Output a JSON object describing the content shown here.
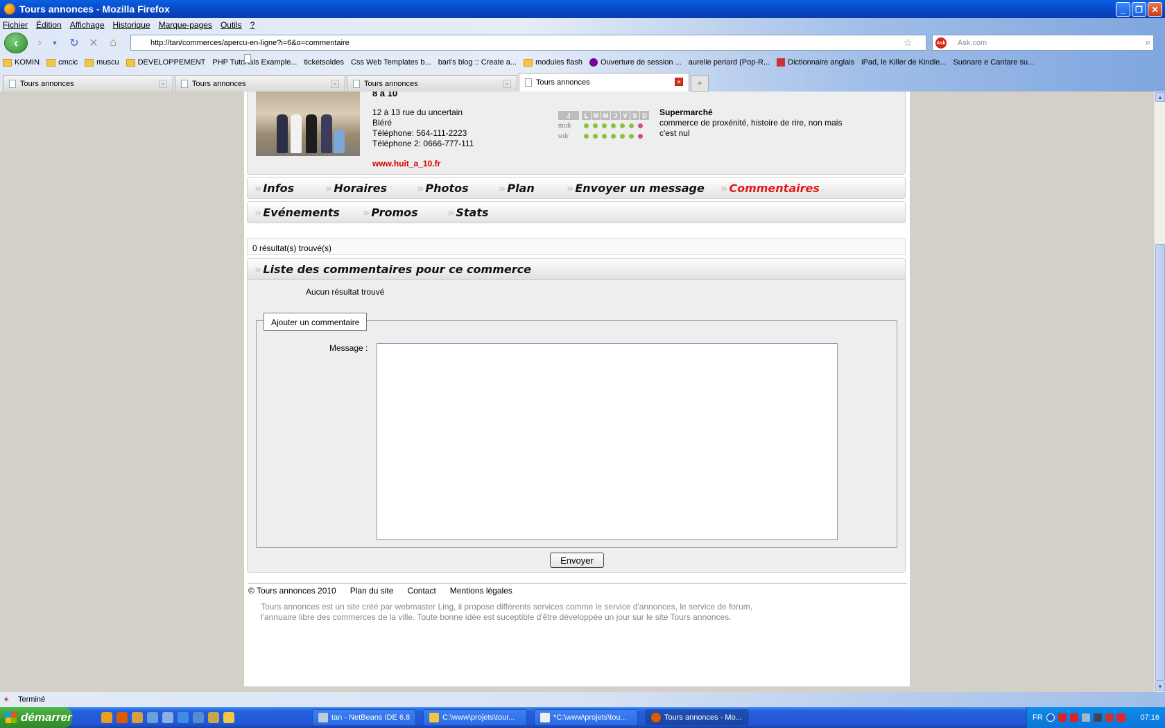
{
  "window": {
    "title": "Tours annonces - Mozilla Firefox"
  },
  "menu": [
    "Fichier",
    "Édition",
    "Affichage",
    "Historique",
    "Marque-pages",
    "Outils",
    "?"
  ],
  "url": "http://tan/commerces/apercu-en-ligne?i=6&o=commentaire",
  "search": {
    "placeholder": "Ask.com"
  },
  "bookmarks": [
    {
      "label": "KOMIN",
      "icon": "folder"
    },
    {
      "label": "cmcic",
      "icon": "folder"
    },
    {
      "label": "muscu",
      "icon": "folder"
    },
    {
      "label": "DEVELOPPEMENT",
      "icon": "folder"
    },
    {
      "label": "PHP Tutorials Example...",
      "icon": "page"
    },
    {
      "label": "ticketsoldes",
      "icon": "page"
    },
    {
      "label": "Css Web Templates b...",
      "icon": "page"
    },
    {
      "label": "bari's blog :: Create a...",
      "icon": "page"
    },
    {
      "label": "modules flash",
      "icon": "folder"
    },
    {
      "label": "Ouverture de session ...",
      "icon": "yahoo"
    },
    {
      "label": "aurelie periard (Pop-R...",
      "icon": "page"
    },
    {
      "label": "Dictionnaire anglais",
      "icon": "wr"
    },
    {
      "label": "iPad, le Killer de Kindle...",
      "icon": "page"
    },
    {
      "label": "Suonare e Cantare su...",
      "icon": "page"
    }
  ],
  "tabs": [
    {
      "label": "Tours annonces",
      "active": false
    },
    {
      "label": "Tours annonces",
      "active": false
    },
    {
      "label": "Tours annonces",
      "active": false
    },
    {
      "label": "Tours annonces",
      "active": true
    }
  ],
  "shop": {
    "name": "8 à 10",
    "address": "12 à 13 rue du uncertain",
    "city": "Bléré",
    "phone1": "Téléphone: 564-111-2223",
    "phone2": "Téléphone 2: 0666-777-111",
    "website": "www.huit_a_10.fr",
    "category": "Supermarché",
    "description": "commerce de proxénité, histoire de rire, non mais c'est nul"
  },
  "hours": {
    "today_label": "J",
    "days": [
      "L",
      "M",
      "M",
      "J",
      "V",
      "S",
      "D"
    ],
    "rows": [
      {
        "label": "midi",
        "open": [
          true,
          true,
          true,
          true,
          true,
          true,
          false
        ]
      },
      {
        "label": "soir",
        "open": [
          true,
          true,
          true,
          true,
          true,
          true,
          false
        ]
      }
    ],
    "colors": {
      "open": "#8ac13a",
      "closed": "#d64a8a"
    }
  },
  "nav": {
    "row1": [
      "Infos",
      "Horaires",
      "Photos",
      "Plan",
      "Envoyer un message",
      "Commentaires"
    ],
    "row2": [
      "Evénements",
      "Promos",
      "Stats"
    ],
    "active": "Commentaires"
  },
  "results_text": "0 résultat(s) trouvé(s)",
  "comments": {
    "heading": "Liste des commentaires pour ce commerce",
    "empty_text": "Aucun résultat trouvé",
    "form_legend": "Ajouter un commentaire",
    "message_label": "Message :",
    "message_value": "",
    "submit_label": "Envoyer"
  },
  "footer": {
    "copyright": "© Tours annonces 2010",
    "links": [
      "Plan du site",
      "Contact",
      "Mentions légales"
    ],
    "text": "Tours annonces est un site créé par webmaster Ling, il propose différents services comme le service d'annonces, le service de forum, l'annuaire libre des commerces de la ville. Toute bonne idée est suceptible d'être développée un jour sur le site Tours annonces."
  },
  "status": "Terminé",
  "taskbar": {
    "start": "démarrer",
    "tasks": [
      "tan - NetBeans IDE 6.8",
      "C:\\www\\projets\\tour...",
      "*C:\\www\\projets\\tou...",
      "Tours annonces - Mo..."
    ],
    "lang": "FR",
    "clock": "07:16"
  }
}
